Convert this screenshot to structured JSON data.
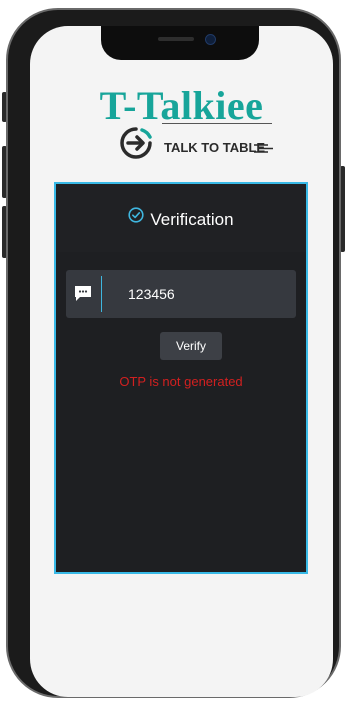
{
  "app": {
    "brand_title": "T-Talkiee",
    "tagline": "TALK TO TABLE",
    "accent_color": "#17a59a",
    "panel_border_color": "#38b9e6",
    "error_color": "#d22020"
  },
  "verification": {
    "title": "Verification",
    "title_icon": "check-circle-icon",
    "otp_icon": "message-icon",
    "otp_value": "123456",
    "verify_label": "Verify",
    "error_message": "OTP is not generated"
  }
}
